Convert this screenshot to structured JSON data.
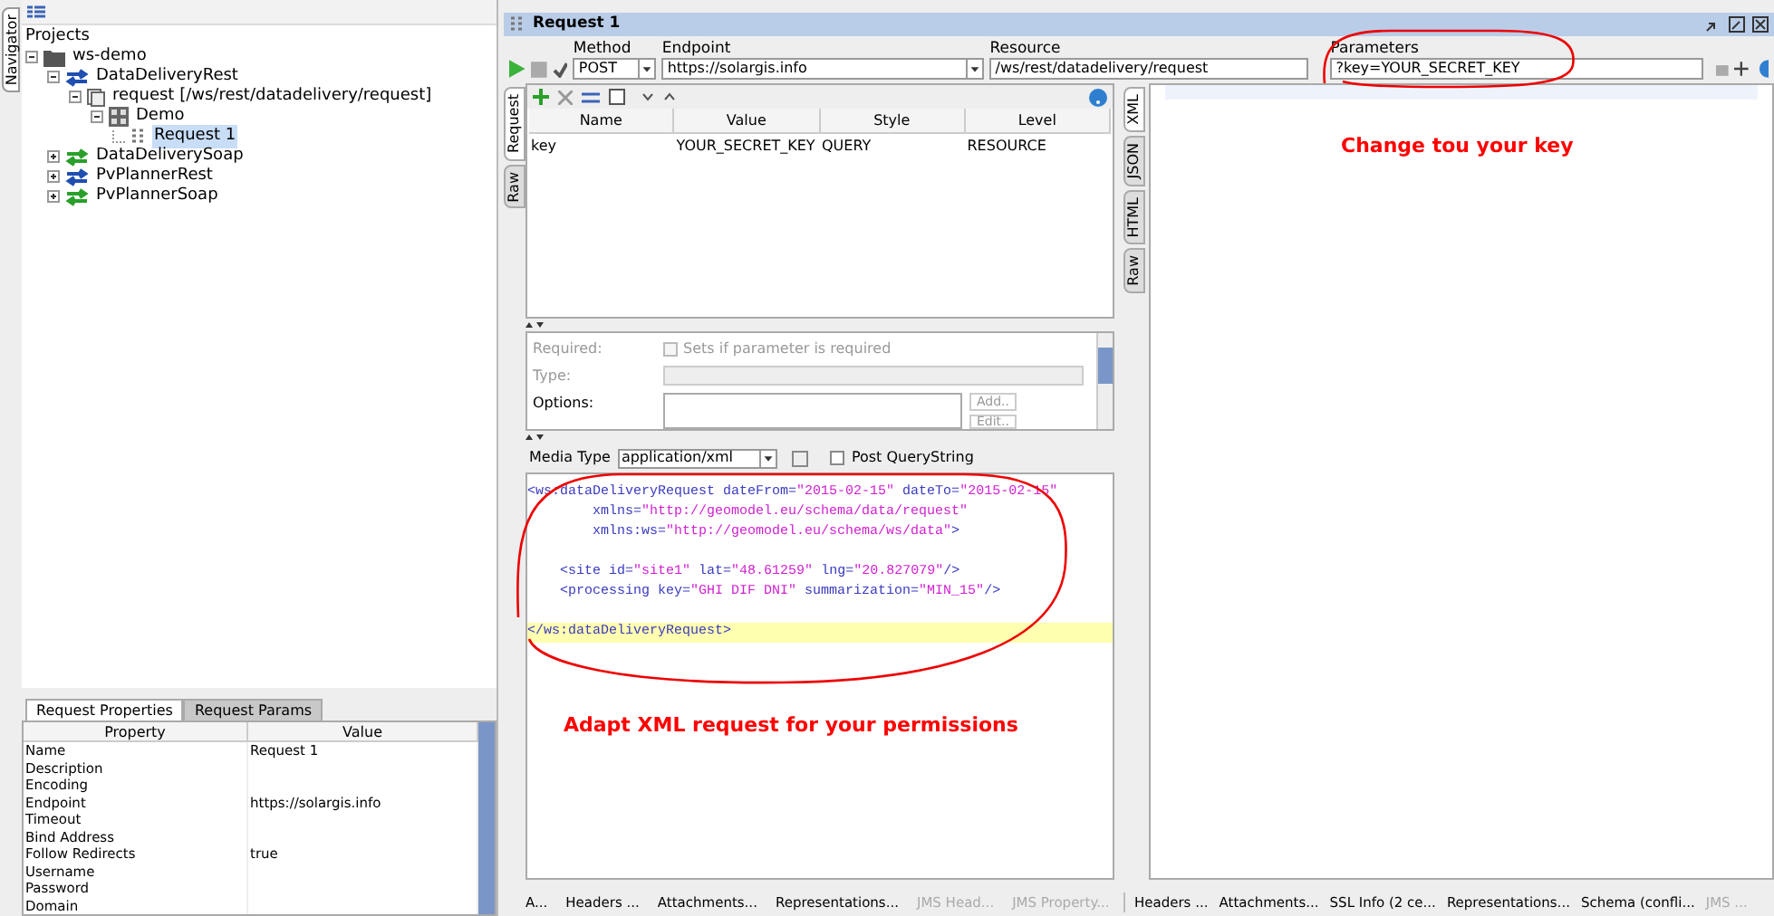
{
  "navigator_tab": {
    "label": "Navigator"
  },
  "tree": {
    "root_label": "Projects",
    "items": [
      {
        "label": "ws-demo",
        "kind": "folder",
        "selected": false,
        "expanded": true,
        "children": [
          {
            "label": "DataDeliveryRest",
            "kind": "rest",
            "selected": false,
            "expanded": true,
            "children": [
              {
                "label": "request [/ws/rest/datadelivery/request]",
                "kind": "resource",
                "selected": false,
                "expanded": true,
                "children": [
                  {
                    "label": "Demo",
                    "kind": "method",
                    "selected": false,
                    "expanded": true,
                    "children": [
                      {
                        "label": "Request 1",
                        "kind": "request",
                        "selected": true
                      }
                    ]
                  }
                ]
              }
            ]
          },
          {
            "label": "DataDeliverySoap",
            "kind": "soap",
            "selected": false,
            "expanded": false
          },
          {
            "label": "PvPlannerRest",
            "kind": "rest",
            "selected": false,
            "expanded": false
          },
          {
            "label": "PvPlannerSoap",
            "kind": "soap",
            "selected": false,
            "expanded": false
          }
        ]
      }
    ]
  },
  "properties": {
    "tabs": [
      {
        "label": "Request Properties",
        "selected": true
      },
      {
        "label": "Request Params",
        "selected": false
      }
    ],
    "columns": [
      "Property",
      "Value"
    ],
    "rows": [
      [
        "Name",
        "Request 1"
      ],
      [
        "Description",
        ""
      ],
      [
        "Encoding",
        ""
      ],
      [
        "Endpoint",
        "https://solargis.info"
      ],
      [
        "Timeout",
        ""
      ],
      [
        "Bind Address",
        ""
      ],
      [
        "Follow Redirects",
        "true"
      ],
      [
        "Username",
        ""
      ],
      [
        "Password",
        ""
      ],
      [
        "Domain",
        ""
      ]
    ]
  },
  "editor": {
    "title": "Request 1",
    "method": {
      "label": "Method",
      "value": "POST"
    },
    "endpoint": {
      "label": "Endpoint",
      "value": "https://solargis.info"
    },
    "resource": {
      "label": "Resource",
      "value": "/ws/rest/datadelivery/request"
    },
    "parameters": {
      "label": "Parameters",
      "value": "?key=YOUR_SECRET_KEY"
    },
    "request_tabs": [
      {
        "label": "Request",
        "selected": true
      },
      {
        "label": "Raw",
        "selected": false
      }
    ],
    "response_tabs": [
      {
        "label": "XML",
        "selected": true
      },
      {
        "label": "JSON",
        "selected": false
      },
      {
        "label": "HTML",
        "selected": false
      },
      {
        "label": "Raw",
        "selected": false
      }
    ],
    "params_table": {
      "columns": [
        "Name",
        "Value",
        "Style",
        "Level"
      ],
      "rows": [
        [
          "key",
          "YOUR_SECRET_KEY",
          "QUERY",
          "RESOURCE"
        ]
      ]
    },
    "param_detail": {
      "required_label": "Required:",
      "required_checkbox": {
        "label": "Sets if parameter is required",
        "checked": false
      },
      "type_label": "Type:",
      "options_label": "Options:",
      "add_button": "Add..",
      "edit_button": "Edit.."
    },
    "media_type": {
      "label": "Media Type",
      "value": "application/xml",
      "post_querystring": {
        "label": "Post QueryString",
        "checked": false
      }
    },
    "xml_lines": [
      {
        "text": "<ws:dataDeliveryRequest dateFrom=\"2015-02-15\" dateTo=\"2015-02-15\"",
        "highlighted": false
      },
      {
        "text": "        xmlns=\"http://geomodel.eu/schema/data/request\"",
        "highlighted": false
      },
      {
        "text": "        xmlns:ws=\"http://geomodel.eu/schema/ws/data\">",
        "highlighted": false
      },
      {
        "highlighted": false
      },
      {
        "text": "    <site id=\"site1\" lat=\"48.61259\" lng=\"20.827079\"/>",
        "highlighted": false
      },
      {
        "text": "    <processing key=\"GHI DIF DNI\" summarization=\"MIN_15\"/>",
        "highlighted": false
      },
      {
        "highlighted": false
      },
      {
        "text": "</ws:dataDeliveryRequest>",
        "highlighted": true
      }
    ],
    "request_bottom_tabs": [
      {
        "label": "A...",
        "disabled": false
      },
      {
        "label": "Headers ...",
        "disabled": false
      },
      {
        "label": "Attachments...",
        "disabled": false
      },
      {
        "label": "Representations...",
        "disabled": false
      },
      {
        "label": "JMS Head...",
        "disabled": true
      },
      {
        "label": "JMS Property...",
        "disabled": true
      }
    ],
    "response_bottom_tabs": [
      {
        "label": "Headers ...",
        "disabled": false
      },
      {
        "label": "Attachments...",
        "disabled": false
      },
      {
        "label": "SSL Info (2 ce...",
        "disabled": false
      },
      {
        "label": "Representations...",
        "disabled": false
      },
      {
        "label": "Schema (confli...",
        "disabled": false
      },
      {
        "label": "JMS ...",
        "disabled": true
      }
    ]
  },
  "annotations": [
    {
      "text": "Change tou your key"
    },
    {
      "text": "Adapt XML request for your permissions"
    }
  ]
}
